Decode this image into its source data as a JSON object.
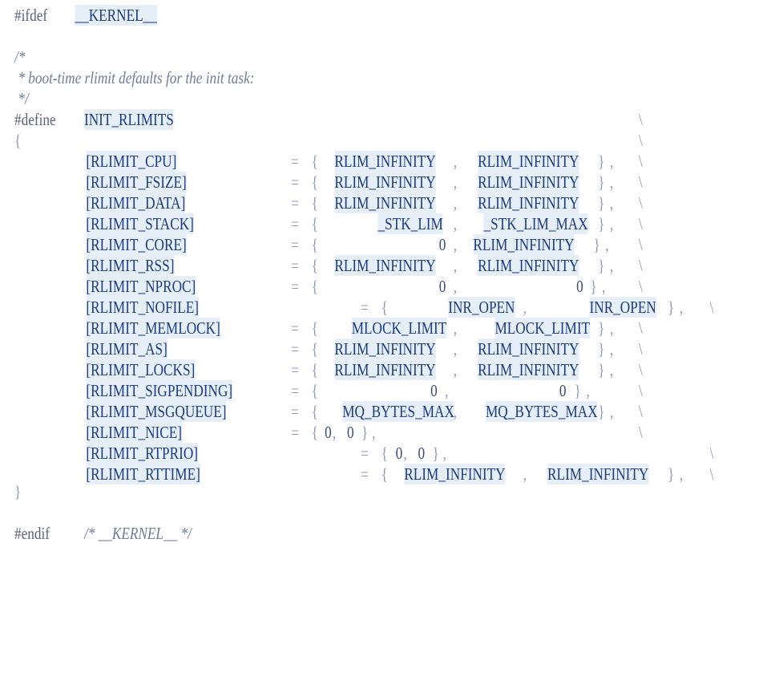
{
  "code": {
    "ifdef_directive": "#ifdef",
    "ifdef_macro": "__KERNEL__",
    "comment_open": "/*",
    "comment_body": " * boot-time rlimit defaults for the init task:",
    "comment_close": " */",
    "define_directive": "#define",
    "define_name": "INIT_RLIMITS",
    "continuation": "\\",
    "open_brace": "{",
    "close_brace": "}",
    "equals": "=",
    "lbrace": "{",
    "rbrace": "}",
    "comma": ",",
    "rows": [
      {
        "key": "[RLIMIT_CPU]",
        "cur": "RLIM_INFINITY",
        "max": "RLIM_INFINITY"
      },
      {
        "key": "[RLIMIT_FSIZE]",
        "cur": "RLIM_INFINITY",
        "max": "RLIM_INFINITY"
      },
      {
        "key": "[RLIMIT_DATA]",
        "cur": "RLIM_INFINITY",
        "max": "RLIM_INFINITY"
      },
      {
        "key": "[RLIMIT_STACK]",
        "cur": "_STK_LIM",
        "max": "_STK_LIM_MAX"
      },
      {
        "key": "[RLIMIT_CORE]",
        "cur": "0",
        "max": "RLIM_INFINITY"
      },
      {
        "key": "[RLIMIT_RSS]",
        "cur": "RLIM_INFINITY",
        "max": "RLIM_INFINITY"
      },
      {
        "key": "[RLIMIT_NPROC]",
        "cur": "0",
        "max": "0"
      },
      {
        "key": "[RLIMIT_NOFILE]",
        "cur": "INR_OPEN",
        "max": "INR_OPEN"
      },
      {
        "key": "[RLIMIT_MEMLOCK]",
        "cur": "MLOCK_LIMIT",
        "max": "MLOCK_LIMIT"
      },
      {
        "key": "[RLIMIT_AS]",
        "cur": "RLIM_INFINITY",
        "max": "RLIM_INFINITY"
      },
      {
        "key": "[RLIMIT_LOCKS]",
        "cur": "RLIM_INFINITY",
        "max": "RLIM_INFINITY"
      },
      {
        "key": "[RLIMIT_SIGPENDING]",
        "cur": "0",
        "max": "0"
      },
      {
        "key": "[RLIMIT_MSGQUEUE]",
        "cur": "MQ_BYTES_MAX",
        "max": "MQ_BYTES_MAX"
      },
      {
        "key": "[RLIMIT_NICE]",
        "cur": "0",
        "max": "0"
      },
      {
        "key": "[RLIMIT_RTPRIO]",
        "cur": "0",
        "max": "0"
      },
      {
        "key": "[RLIMIT_RTTIME]",
        "cur": "RLIM_INFINITY",
        "max": "RLIM_INFINITY"
      }
    ],
    "endif_directive": "#endif",
    "endif_comment": "/* __KERNEL__ */"
  }
}
